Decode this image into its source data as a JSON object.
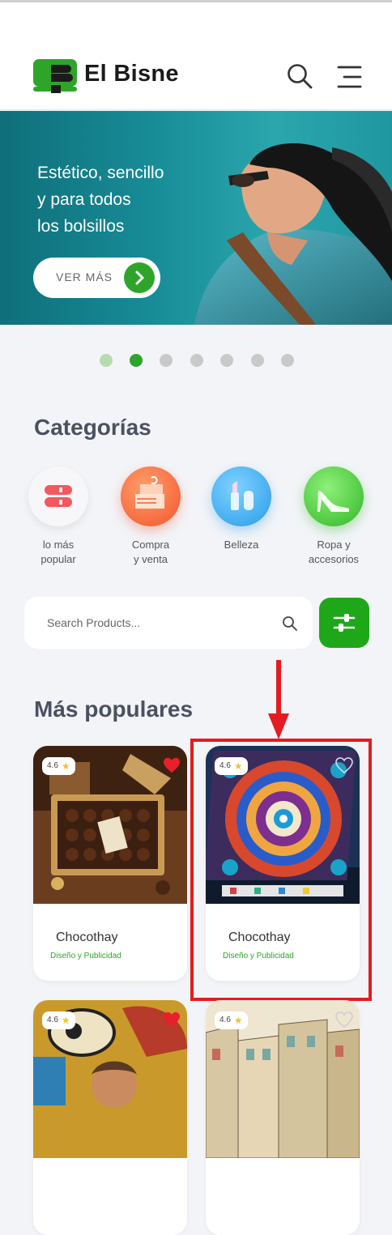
{
  "header": {
    "brand": "El Bisne"
  },
  "banner": {
    "lines": [
      "Estético, sencillo",
      "y para todos",
      "los bolsillos"
    ],
    "button_label": "VER MÁS"
  },
  "carousel": {
    "slides": 7,
    "active_index": 1
  },
  "categories": {
    "title": "Categorías",
    "items": [
      {
        "label1": "lo más",
        "label2": "popular",
        "icon": "stack-icon"
      },
      {
        "label1": "Compra",
        "label2": "y venta",
        "icon": "shop-icon"
      },
      {
        "label1": "Belleza",
        "label2": "",
        "icon": "lipstick-icon"
      },
      {
        "label1": "Ropa y",
        "label2": "accesorios",
        "icon": "high-heel-icon"
      }
    ]
  },
  "search": {
    "placeholder": "Search Products..."
  },
  "popular": {
    "title": "Más populares",
    "products": [
      {
        "rating": "4.6",
        "name": "Chocothay",
        "category": "Diseño y Publicidad",
        "favorite": true
      },
      {
        "rating": "4.6",
        "name": "Chocothay",
        "category": "Diseño y Publicidad",
        "favorite": false
      },
      {
        "rating": "4.6",
        "favorite": true
      },
      {
        "rating": "4.6",
        "favorite": false
      }
    ]
  },
  "colors": {
    "accent": "#2ea52a",
    "banner": "#178d98",
    "heart": "#e8202a",
    "highlight": "#e41b20"
  }
}
